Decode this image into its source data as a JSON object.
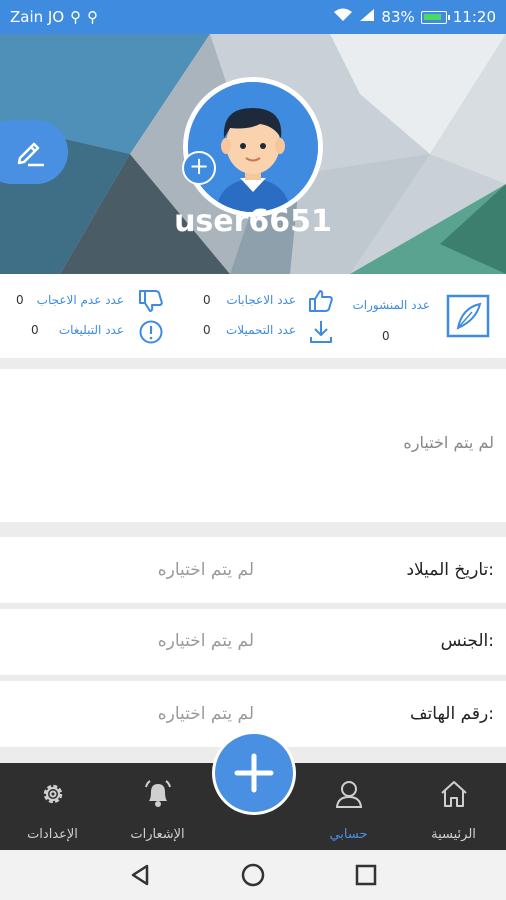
{
  "status_bar": {
    "carrier": "Zain JO",
    "battery": "83%",
    "time": "11:20"
  },
  "profile": {
    "username": "user6651"
  },
  "stats": {
    "posts_label": "عدد المنشورات",
    "posts_value": "0",
    "likes_label": "عدد الاعجابات",
    "likes_value": "0",
    "dislikes_label": "عدد عدم الاعجاب",
    "dislikes_value": "0",
    "downloads_label": "عدد التحميلات",
    "downloads_value": "0",
    "reports_label": "عدد التبليغات",
    "reports_value": "0"
  },
  "about": {
    "text": "لم يتم اختياره"
  },
  "fields": [
    {
      "label": "تاريخ الميلاد:",
      "value": "لم يتم اختياره"
    },
    {
      "label": "الجنس:",
      "value": "لم يتم اختياره"
    },
    {
      "label": "رقم الهاتف:",
      "value": "لم يتم اختياره"
    }
  ],
  "nav": {
    "home": "الرئيسية",
    "account": "حسابي",
    "notifications": "الإشعارات",
    "settings": "الإعدادات"
  },
  "colors": {
    "accent": "#4a90e2",
    "status_bar": "#3f8be0",
    "nav_bg": "#2f2f2f"
  }
}
